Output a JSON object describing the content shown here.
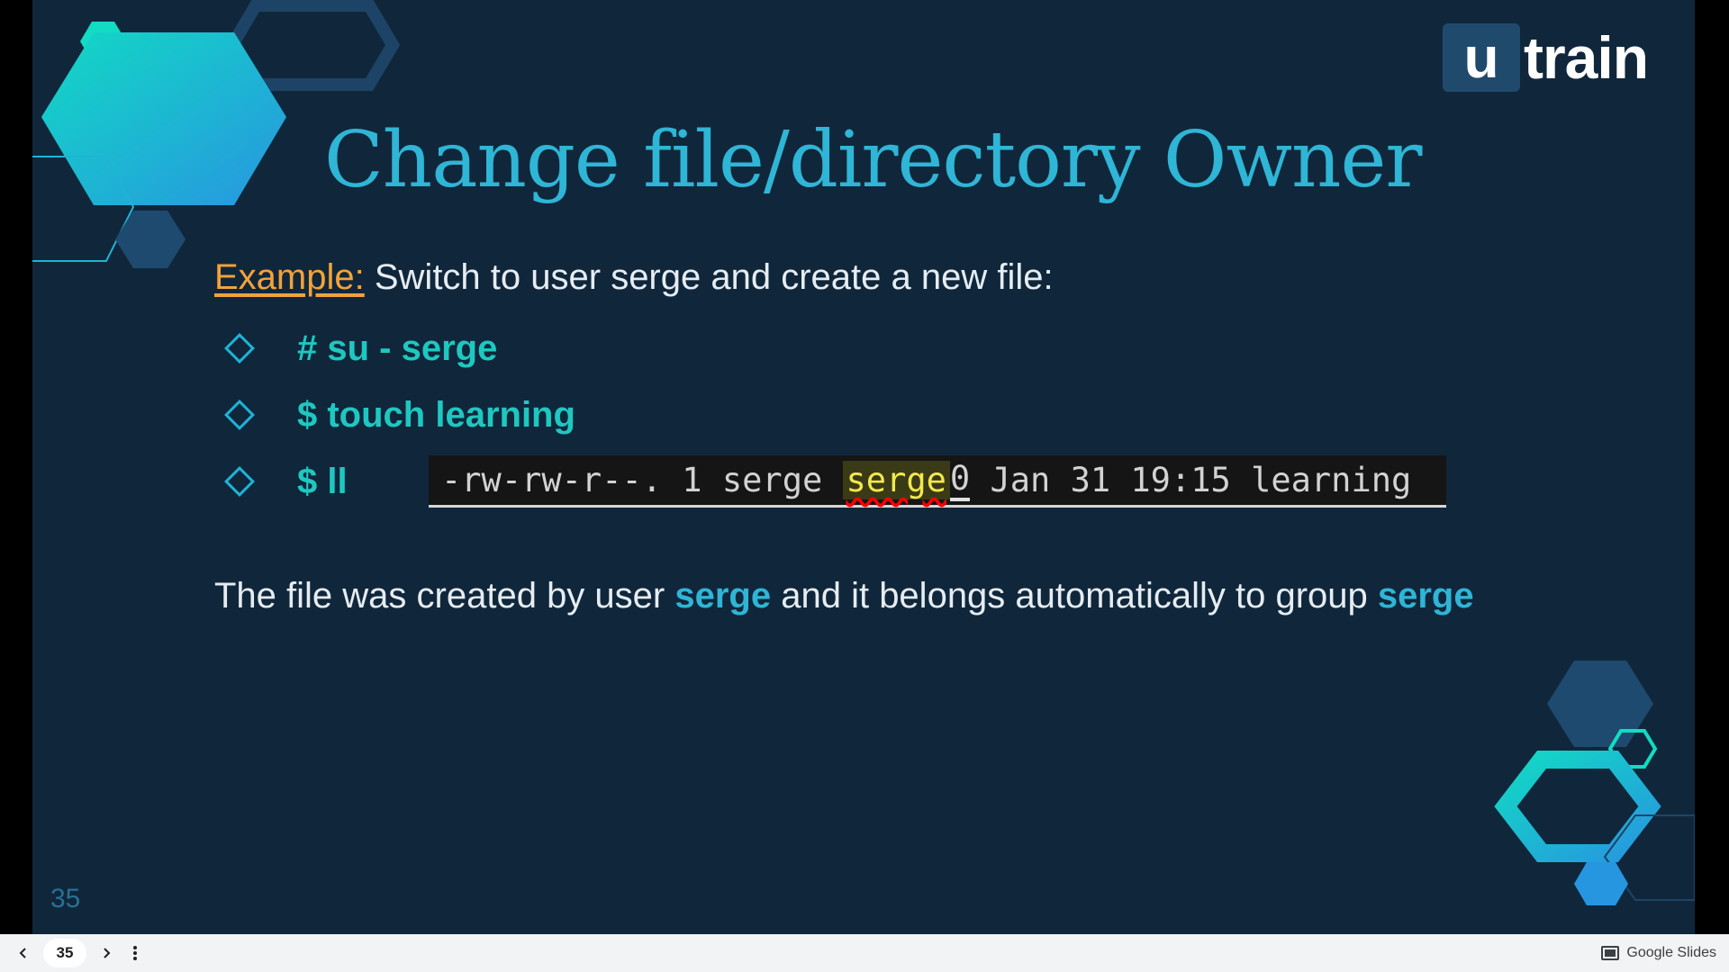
{
  "logo": {
    "mark": "u",
    "text": "train"
  },
  "slide": {
    "title": "Change file/directory Owner",
    "example_label": "Example:",
    "example_text": " Switch to user serge and create a new file:",
    "bullets": [
      {
        "icon": "diamond-icon",
        "text": "# su - serge"
      },
      {
        "icon": "diamond-icon",
        "text": "$ touch learning"
      },
      {
        "icon": "diamond-icon",
        "text": "$ ll"
      }
    ],
    "terminal": {
      "prefix": "-rw-rw-r--. 1 serge ",
      "highlight": "serge",
      "cursor_char": "0",
      "suffix": " Jan 31 19:15 learning"
    },
    "description": {
      "before": "The file was created by user ",
      "user": "serge",
      "middle": " and it belongs automatically to group ",
      "group": "serge"
    },
    "page_number": "35"
  },
  "viewer": {
    "current_page": "35",
    "brand": "Google Slides"
  },
  "colors": {
    "background": "#10273b",
    "title": "#2fb5d6",
    "command": "#1ec8c0",
    "example_label": "#f2a23b"
  }
}
